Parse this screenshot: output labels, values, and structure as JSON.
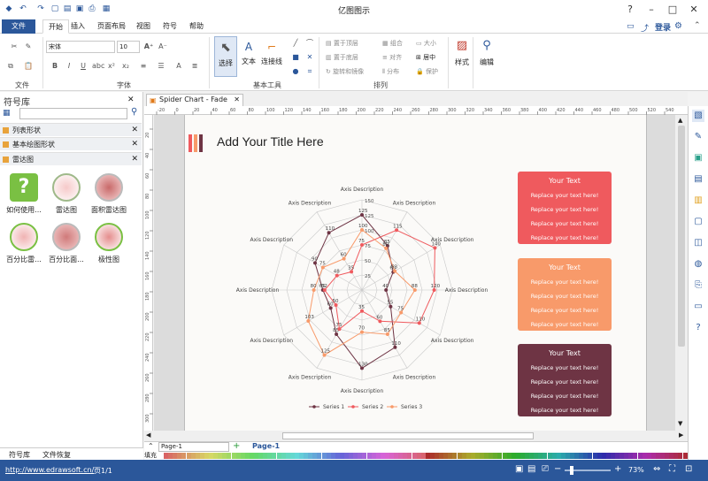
{
  "app": {
    "title": "亿图图示",
    "login": "登录"
  },
  "menu": {
    "file": "文件",
    "tabs": [
      "开始",
      "插入",
      "页面布局",
      "视图",
      "符号",
      "帮助"
    ]
  },
  "ribbon": {
    "font_name": "宋体",
    "font_size": "10",
    "groups": {
      "file": "文件",
      "font": "字体",
      "basic_tools": "基本工具",
      "arrange": "排列"
    },
    "tools": {
      "select": "选择",
      "text": "文本",
      "connector": "连接线",
      "style": "样式",
      "edit": "编辑"
    },
    "arrange": {
      "bring_front": "置于顶层",
      "send_back": "置于底层",
      "rotate_mirror": "旋转和镜像",
      "group": "组合",
      "align": "对齐",
      "distribute": "分布",
      "size": "大小",
      "center": "居中",
      "protect": "保护"
    }
  },
  "library": {
    "title": "符号库",
    "search_placeholder": "",
    "categories": [
      "列表形状",
      "基本绘图形状",
      "雷达图"
    ],
    "shapes": [
      "如何使用...",
      "雷达图",
      "面积雷达图",
      "百分比雷...",
      "百分比面...",
      "极性图"
    ],
    "bottom_tabs": [
      "符号库",
      "文件恢复"
    ]
  },
  "document": {
    "tab": "Spider Chart - Fade",
    "page_title": "Add Your Title Here",
    "page_tab": "Page-1",
    "page_select": "Page-1",
    "fill_label": "填充"
  },
  "ruler_h": [
    "-20",
    "0",
    "20",
    "40",
    "60",
    "80",
    "100",
    "120",
    "140",
    "160",
    "180",
    "200",
    "220",
    "240",
    "260",
    "280",
    "300",
    "320",
    "340",
    "360",
    "380",
    "400",
    "420",
    "440",
    "460",
    "480",
    "500",
    "520",
    "540"
  ],
  "ruler_v": [
    "20",
    "40",
    "60",
    "80",
    "100",
    "120",
    "140",
    "160",
    "180",
    "200",
    "220",
    "240",
    "260",
    "280",
    "300"
  ],
  "text_boxes": [
    {
      "heading": "Your Text",
      "lines": [
        "Replace your text here!",
        "Replace your text here!",
        "Replace your text here!",
        "Replace your text here!"
      ],
      "color": "#ef5a5e"
    },
    {
      "heading": "Your Text",
      "lines": [
        "Replace your text here!",
        "Replace your text here!",
        "Replace your text here!",
        "Replace your text here!"
      ],
      "color": "#f89a6a"
    },
    {
      "heading": "Your Text",
      "lines": [
        "Replace your text here!",
        "Replace your text here!",
        "Replace your text here!",
        "Replace your text here!"
      ],
      "color": "#6e3444"
    }
  ],
  "status": {
    "url": "http://www.edrawsoft.cn/",
    "page": "页1/1",
    "zoom": "73%"
  },
  "chart_data": {
    "type": "radar",
    "title": "",
    "axis_label": "Axis Description",
    "axes_count": 12,
    "rmax": 150,
    "ring_count": 6,
    "scale_labels": [
      "25",
      "50",
      "75",
      "100",
      "125",
      "150"
    ],
    "series": [
      {
        "name": "Series 1",
        "color": "#6e3444",
        "values": [
          125,
          85,
          60,
          40,
          55,
          110,
          130,
          85,
          60,
          65,
          90,
          110
        ]
      },
      {
        "name": "Series 2",
        "color": "#ef5a5e",
        "values": [
          75,
          115,
          140,
          120,
          110,
          60,
          35,
          75,
          50,
          62,
          48,
          35
        ]
      },
      {
        "name": "Series 3",
        "color": "#f89a6a",
        "values": [
          100,
          80,
          63,
          88,
          75,
          85,
          70,
          125,
          103,
          80,
          75,
          60
        ]
      }
    ],
    "legend": [
      "Series 1",
      "Series 2",
      "Series 3"
    ],
    "grid": true,
    "legend_position": "bottom"
  }
}
